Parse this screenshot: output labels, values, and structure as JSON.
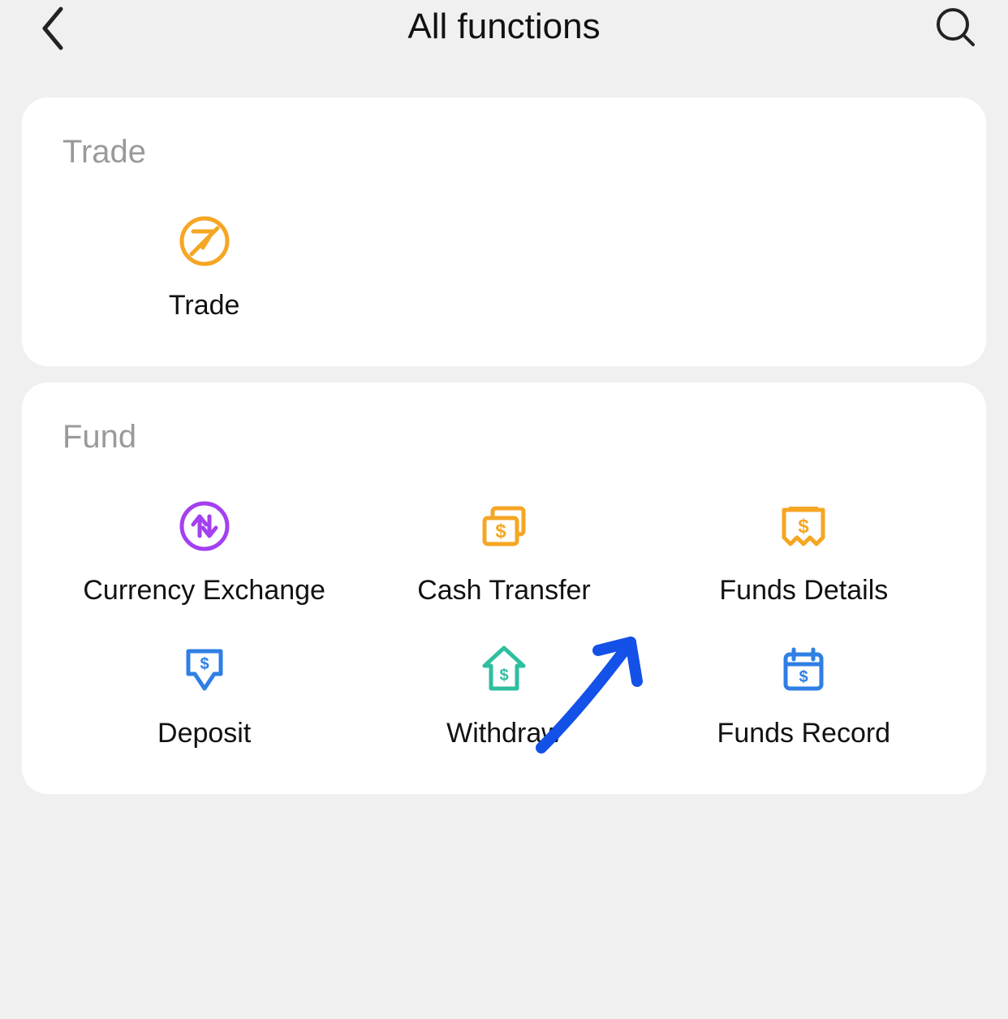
{
  "header": {
    "title": "All functions"
  },
  "sections": {
    "trade": {
      "title": "Trade",
      "items": {
        "trade": "Trade"
      }
    },
    "fund": {
      "title": "Fund",
      "items": {
        "currency_exchange": "Currency Exchange",
        "cash_transfer": "Cash Transfer",
        "funds_details": "Funds Details",
        "deposit": "Deposit",
        "withdraw": "Withdraw",
        "funds_record": "Funds Record"
      }
    }
  },
  "colors": {
    "orange": "#F5A623",
    "purple": "#A340F0",
    "teal": "#2FBF9F",
    "blue": "#2F7FE5",
    "annotation": "#1351E8"
  }
}
